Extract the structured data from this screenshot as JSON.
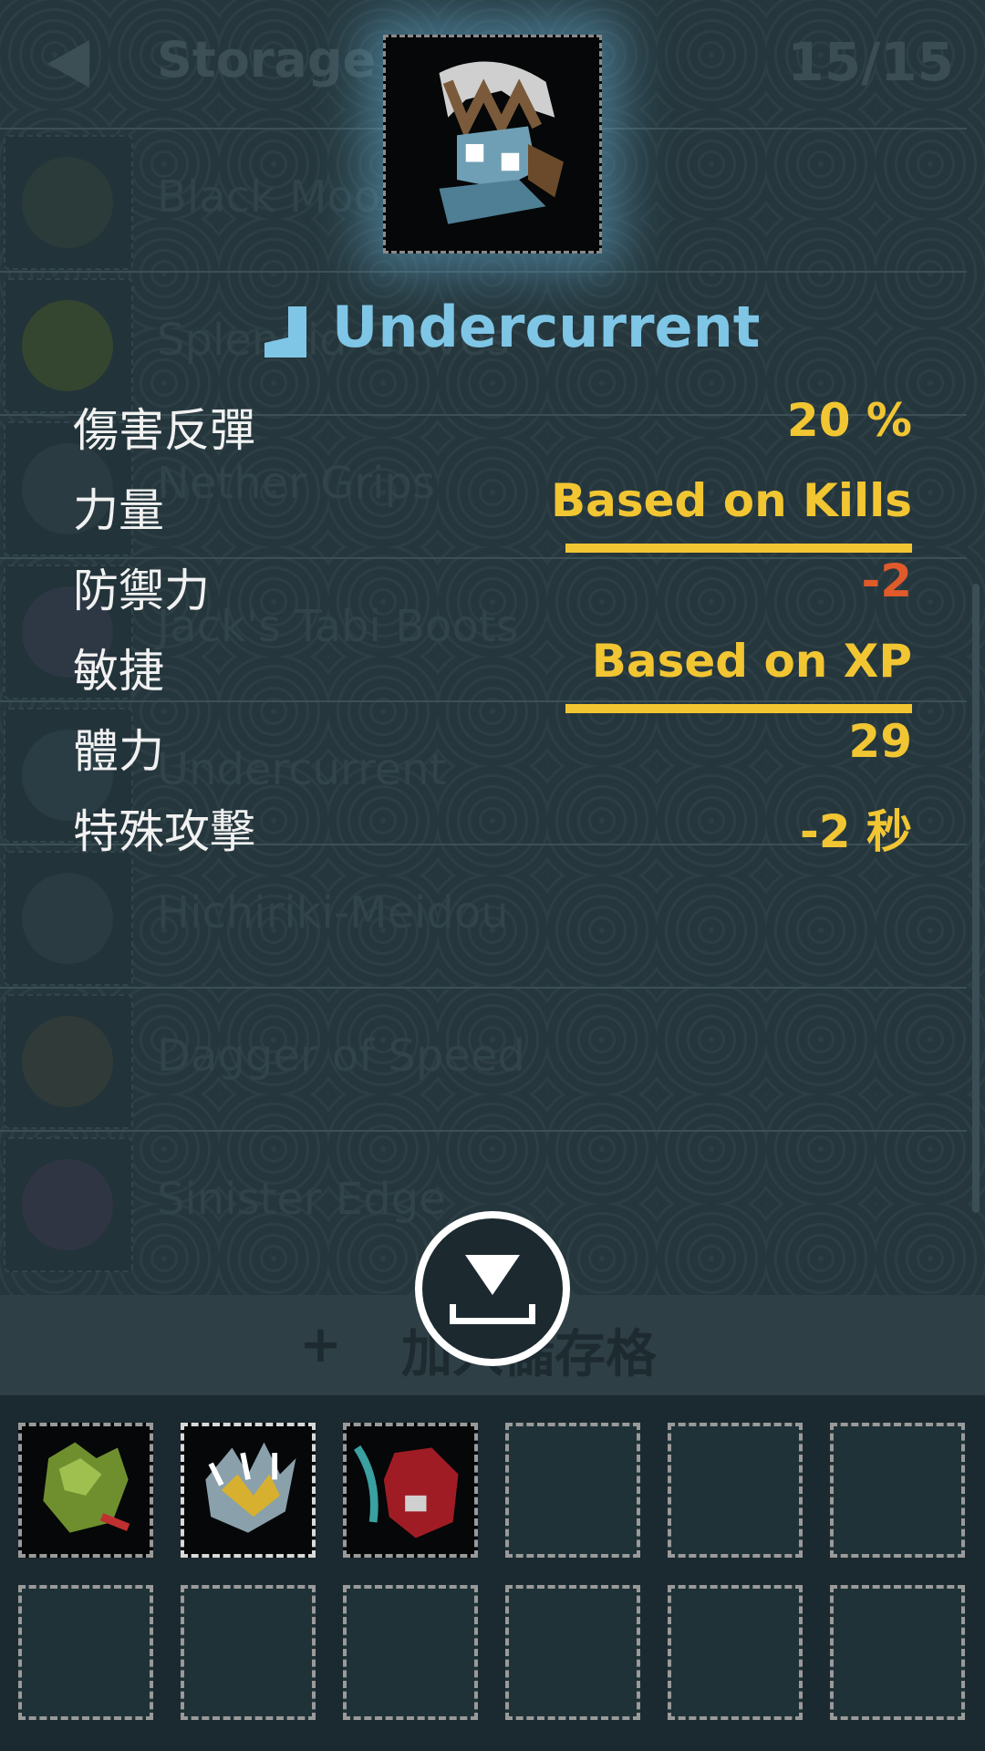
{
  "header": {
    "back_icon": "back-arrow-icon",
    "title": "Storage",
    "count": "15/15"
  },
  "storage_list": [
    {
      "name": "Black Moon",
      "color": "#3a4a3a"
    },
    {
      "name": "Splendid Gloves",
      "color": "#5a6a20"
    },
    {
      "name": "Nether Grips",
      "color": "#3a4a50"
    },
    {
      "name": "Jack's Tabi Boots",
      "color": "#44405a"
    },
    {
      "name": "Undercurrent",
      "color": "#3a5058"
    },
    {
      "name": "Hichiriki-Meidou",
      "color": "#3a4a50"
    },
    {
      "name": "Dagger of Speed",
      "color": "#4a4a3a"
    },
    {
      "name": "Sinister Edge",
      "color": "#4a3a5a"
    }
  ],
  "item_popup": {
    "icon": "boot-icon",
    "name": "Undercurrent",
    "stats": [
      {
        "label": "傷害反彈",
        "value": "20 %",
        "negative": false,
        "underlined": false
      },
      {
        "label": "力量",
        "value": "Based on Kills",
        "negative": false,
        "underlined": true
      },
      {
        "label": "防禦力",
        "value": "-2",
        "negative": true,
        "underlined": false
      },
      {
        "label": "敏捷",
        "value": "Based on XP",
        "negative": false,
        "underlined": true
      },
      {
        "label": "體力",
        "value": "29",
        "negative": false,
        "underlined": false
      },
      {
        "label": "特殊攻擊",
        "value": "-2 秒",
        "negative": false,
        "underlined": false
      }
    ]
  },
  "store_bar": {
    "plus": "+",
    "label": "加入儲存格",
    "button_icon": "store-download-icon"
  },
  "inventory": {
    "slots": [
      {
        "item": "green-gauntlet-icon",
        "filled": true,
        "selected": false
      },
      {
        "item": "gold-claw-icon",
        "filled": true,
        "selected": true
      },
      {
        "item": "red-glove-icon",
        "filled": true,
        "selected": false
      },
      {
        "item": "",
        "filled": false,
        "selected": false
      },
      {
        "item": "",
        "filled": false,
        "selected": false
      },
      {
        "item": "",
        "filled": false,
        "selected": false
      },
      {
        "item": "",
        "filled": false,
        "selected": false
      },
      {
        "item": "",
        "filled": false,
        "selected": false
      },
      {
        "item": "",
        "filled": false,
        "selected": false
      },
      {
        "item": "",
        "filled": false,
        "selected": false
      },
      {
        "item": "",
        "filled": false,
        "selected": false
      },
      {
        "item": "",
        "filled": false,
        "selected": false
      }
    ]
  },
  "colors": {
    "accent_blue": "#7fc6e6",
    "stat_yellow": "#f2c632",
    "stat_negative": "#e05a2a"
  }
}
